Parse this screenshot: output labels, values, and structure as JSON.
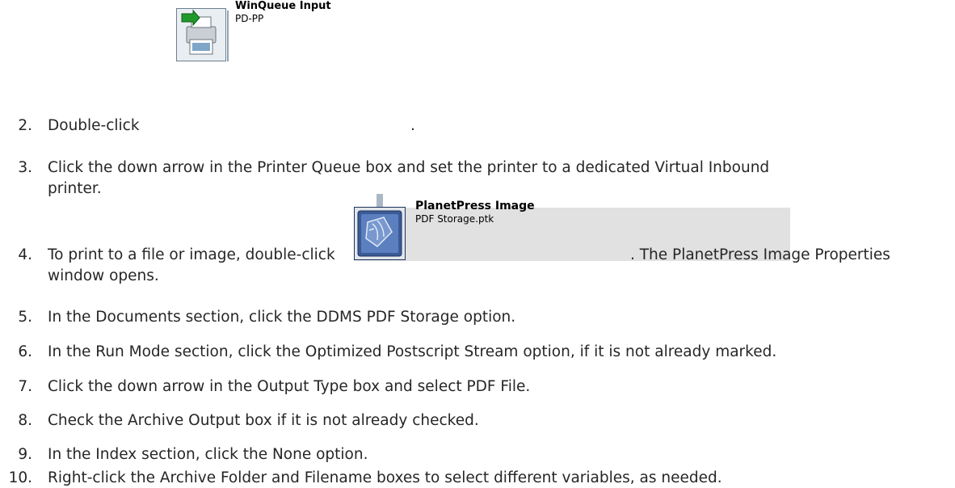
{
  "steps": [
    {
      "num": "2.",
      "text": "Double-click",
      "after": "."
    },
    {
      "num": "3.",
      "line1": "Click the down arrow in the Printer Queue box and set the printer to a dedicated Virtual Inbound",
      "line2": "printer."
    },
    {
      "num": "4.",
      "text": "To print to a file or image, double-click",
      "after": ". The PlanetPress Image Properties",
      "line2": "window opens."
    },
    {
      "num": "5.",
      "text": "In the Documents section, click the DDMS PDF Storage option."
    },
    {
      "num": "6.",
      "text": "In the Run Mode section, click the Optimized Postscript Stream option, if it is not already marked."
    },
    {
      "num": "7.",
      "text": "Click the down arrow in the Output Type box and select PDF File."
    },
    {
      "num": "8.",
      "text": "Check the Archive Output box if it is not already checked."
    },
    {
      "num": "9.",
      "text": "In the Index section, click the None option."
    },
    {
      "num": "10.",
      "text": "Right-click the Archive Folder and Filename boxes to select different variables, as needed."
    }
  ],
  "icons": {
    "winqueue": {
      "title": "WinQueue Input",
      "subtitle": "PD-PP"
    },
    "planetpress": {
      "title": "PlanetPress Image",
      "subtitle": "PDF Storage.ptk"
    }
  },
  "colors": {
    "text": "#262626",
    "icon_tile": "#e9eef2",
    "planetpress_blue": "#3a5b96"
  }
}
